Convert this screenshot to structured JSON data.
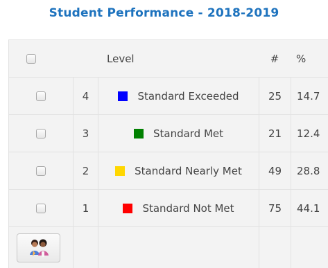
{
  "title": "Student Performance - 2018-2019",
  "table": {
    "headers": {
      "level": "Level",
      "count": "#",
      "percent": "%"
    },
    "rows": [
      {
        "num": "4",
        "label": "Standard Exceeded",
        "count": "25",
        "percent": "14.7",
        "color": "#0000ff"
      },
      {
        "num": "3",
        "label": "Standard Met",
        "count": "21",
        "percent": "12.4",
        "color": "#008000"
      },
      {
        "num": "2",
        "label": "Standard Nearly Met",
        "count": "49",
        "percent": "28.8",
        "color": "#ffd700"
      },
      {
        "num": "1",
        "label": "Standard Not Met",
        "count": "75",
        "percent": "44.1",
        "color": "#ff0000"
      }
    ]
  },
  "icons": {
    "footer_button": "students-icon"
  }
}
